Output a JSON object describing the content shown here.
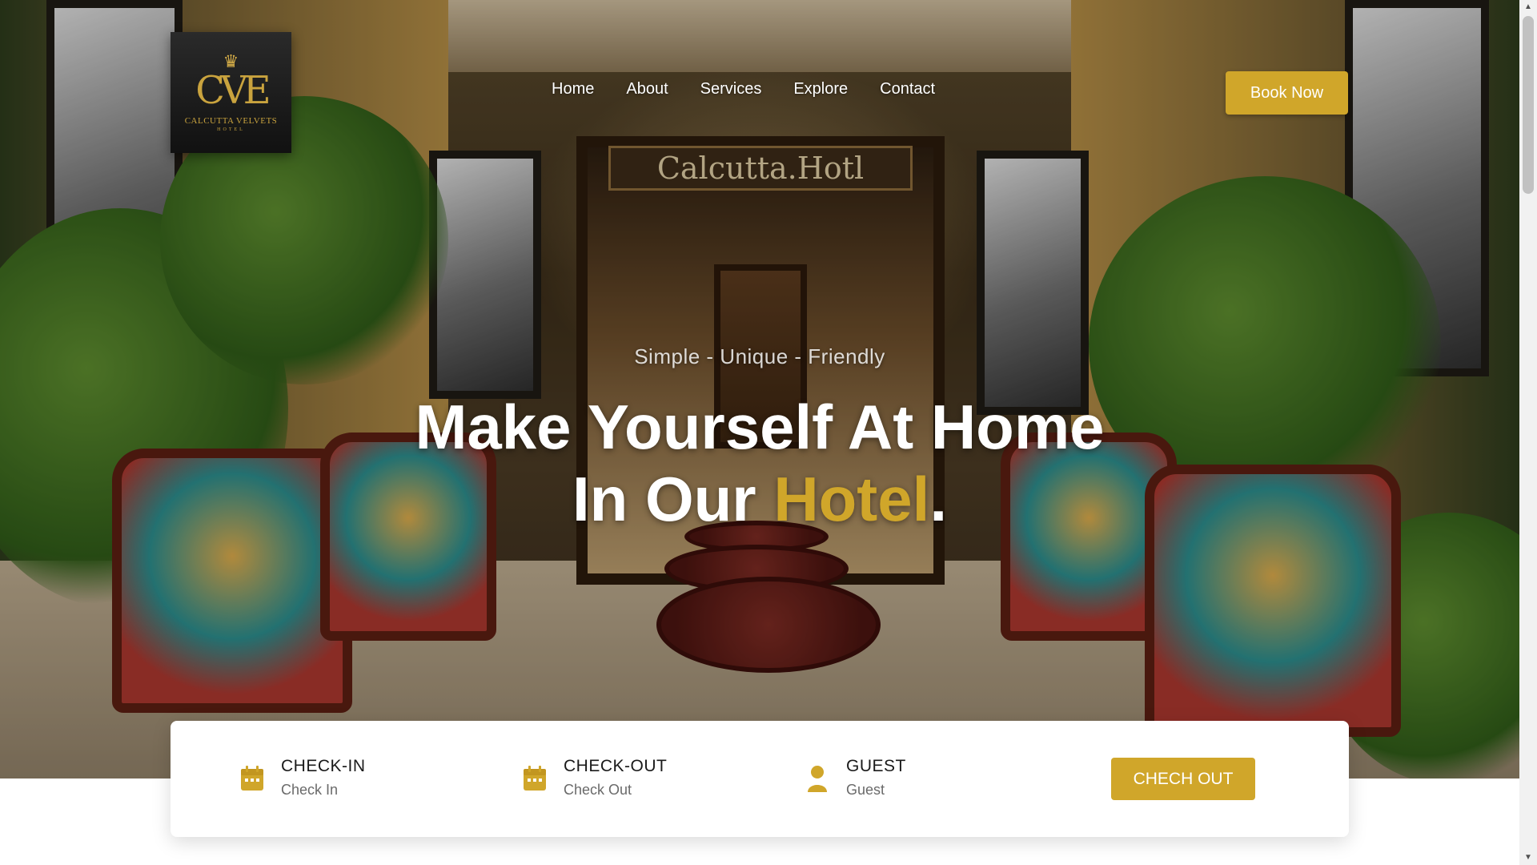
{
  "brand": {
    "logo_mark": "CVE",
    "logo_name": "CALCUTTA VELVETS",
    "logo_sub": "HOTEL",
    "logo_icon": "crown-icon",
    "hero_sign": "Calcutta.Hotl"
  },
  "nav": {
    "items": [
      {
        "label": "Home"
      },
      {
        "label": "About"
      },
      {
        "label": "Services"
      },
      {
        "label": "Explore"
      },
      {
        "label": "Contact"
      }
    ],
    "book_label": "Book Now"
  },
  "hero": {
    "tagline": "Simple - Unique - Friendly",
    "headline_line1": "Make Yourself At Home",
    "headline_line2_pre": "In Our ",
    "headline_accent": "Hotel",
    "headline_end": "."
  },
  "booking": {
    "checkin": {
      "title": "CHECK-IN",
      "value": "Check In",
      "icon": "calendar-icon"
    },
    "checkout": {
      "title": "CHECK-OUT",
      "value": "Check Out",
      "icon": "calendar-icon"
    },
    "guest": {
      "title": "GUEST",
      "value": "Guest",
      "icon": "user-icon"
    },
    "button_label": "CHECH OUT"
  },
  "colors": {
    "accent": "#d0a62a",
    "text_dark": "#1a1a1a",
    "text_muted": "#6a6a6a",
    "logo_bg": "#1c1c1c"
  }
}
